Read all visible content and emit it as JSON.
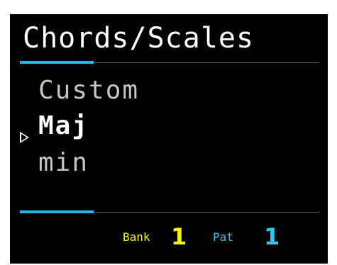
{
  "header": {
    "title": "Chords/Scales"
  },
  "menu": {
    "items": [
      {
        "label": "Custom",
        "selected": false
      },
      {
        "label": "Maj",
        "selected": true
      },
      {
        "label": "min",
        "selected": false
      }
    ],
    "cursor_icon": "triangle-right-icon"
  },
  "status_bar": {
    "bank_label": "Bank",
    "bank_value": "1",
    "pattern_label": "Pat",
    "pattern_value": "1"
  },
  "colors": {
    "background": "#000000",
    "accent": "#29b6e6",
    "status_bank": "#f5f500",
    "status_pattern": "#29c8f0",
    "text_primary": "#ffffff",
    "text_dim": "#c4c4c4"
  }
}
